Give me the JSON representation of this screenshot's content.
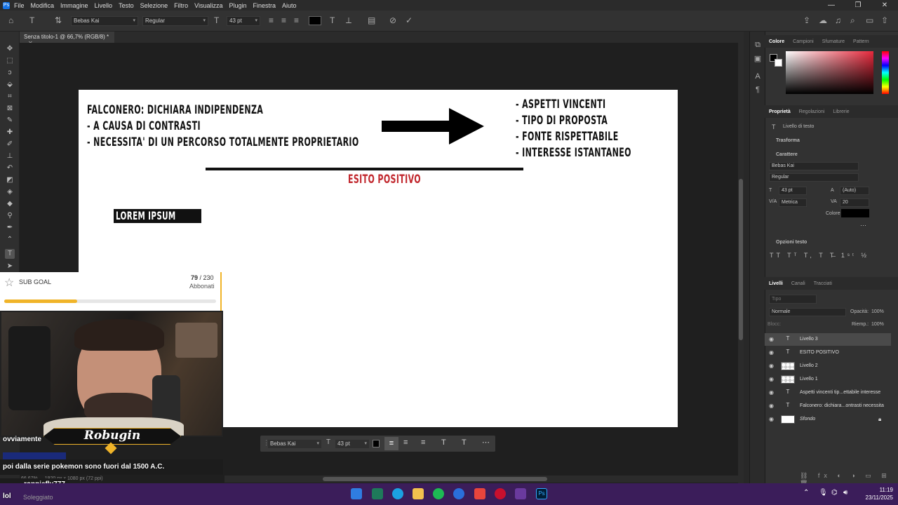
{
  "menubar": {
    "items": [
      "File",
      "Modifica",
      "Immagine",
      "Livello",
      "Testo",
      "Selezione",
      "Filtro",
      "Visualizza",
      "Plugin",
      "Finestra",
      "Aiuto"
    ]
  },
  "options": {
    "font_family": "Bebas Kai",
    "font_style": "Regular",
    "font_size": "43 pt"
  },
  "document": {
    "tab_title": "Senza titolo-1 @ 66,7% (RGB/8) *",
    "left_lines": [
      "FALCONERO: DICHIARA INDIPENDENZA",
      "-  A CAUSA DI CONTRASTI",
      "-  NECESSITA' DI UN PERCORSO TOTALMENTE PROPRIETARIO"
    ],
    "right_lines": [
      "-  ASPETTI VINCENTI",
      "-  TIPO DI PROPOSTA",
      "-  FONTE RISPETTABILE",
      "-  INTERESSE ISTANTANEO"
    ],
    "esito": "ESITO POSITIVO",
    "lorem": "LOREM IPSUM"
  },
  "floatbar": {
    "font_family": "Bebas Kai",
    "font_size": "43 pt"
  },
  "status": {
    "zoom": "66,67%",
    "doc_size": "1920 px x 1080 px (72 ppi)"
  },
  "panels": {
    "color_tabs": [
      "Colore",
      "Campioni",
      "Sfumature",
      "Pattern"
    ],
    "prop_tabs": [
      "Proprietà",
      "Regolazioni",
      "Librerie"
    ],
    "prop_kind": "Livello di testo",
    "trasforma": "Trasforma",
    "carattere": "Carattere",
    "char_font": "Bebas Kai",
    "char_style": "Regular",
    "char_size": "43 pt",
    "char_leading": "(Auto)",
    "char_kerning": "Metrica",
    "char_tracking": "20",
    "colore_label": "Colore",
    "opzioni_testo": "Opzioni testo",
    "layer_tabs": [
      "Livelli",
      "Canali",
      "Tracciati"
    ],
    "search_placeholder": "Tipo",
    "blend_mode": "Normale",
    "opacity_label": "Opacità:",
    "opacity": "100%",
    "fill_label": "Riemp.:",
    "fill": "100%",
    "lock_label": "Blocc:",
    "layers": [
      "Livello 3",
      "ESITO POSITIVO",
      "Livello 2",
      "Livello 1",
      "Aspetti vincenti tip...ettabile interesse",
      "Falconero: dichiara...ontrasti necessita",
      "Sfondo"
    ]
  },
  "stream": {
    "subgoal_label": "SUB GOAL",
    "subgoal_current": "79",
    "subgoal_total": "/ 230",
    "subgoal_unit": "Abbonati",
    "subgoal_progress": 0.343,
    "streamer_name": "Robugin",
    "chat": [
      "ovviamente",
      "poi dalla serie pokemon sono fuori dal 1500 A.C.",
      "ronniefly777",
      "lol"
    ],
    "chat_sub": "Soleggiato"
  },
  "taskbar": {
    "time": "11:19",
    "date": "23/11/2025"
  },
  "colors": {
    "accent_red": "#c1272d",
    "gold": "#f0b429",
    "taskbar": "#3b1d5a"
  }
}
